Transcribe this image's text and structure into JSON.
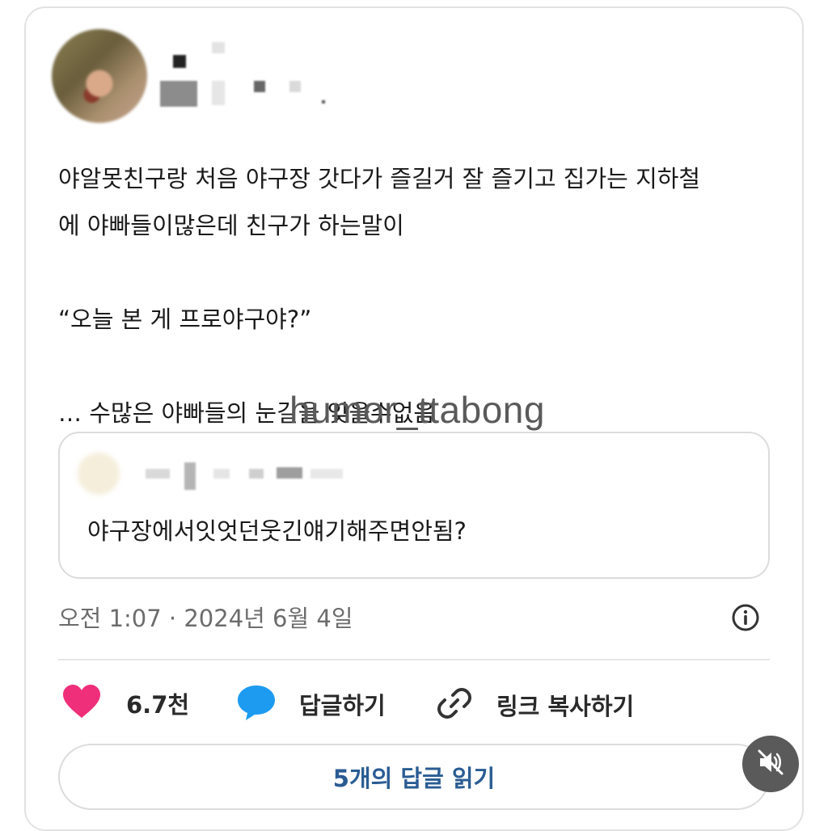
{
  "post": {
    "text": "야알못친구랑 처음 야구장 갓다가 즐길거 잘 즐기고 집가는 지하철\n에 야빠들이많은데 친구가 하는말이\n\n“오늘 본 게 프로야구야?”\n\n… 수많은 야빠들의 눈길을 잊을수없음"
  },
  "watermark": "humor_ttabong",
  "quoted_post": {
    "text": "야구장에서잇엇던웃긴얘기해주면안됨?"
  },
  "timestamp": "오전 1:07 · 2024년 6월 4일",
  "actions": {
    "like_count": "6.7천",
    "reply_label": "답글하기",
    "copy_link_label": "링크 복사하기"
  },
  "read_replies_label": "5개의 답글 읽기",
  "colors": {
    "heart": "#ef2f7a",
    "reply_bubble": "#1d9bf0",
    "read_replies_text": "#2a5c93"
  },
  "icons": [
    "heart-icon",
    "reply-bubble-icon",
    "link-icon",
    "info-icon",
    "speaker-muted-icon"
  ]
}
